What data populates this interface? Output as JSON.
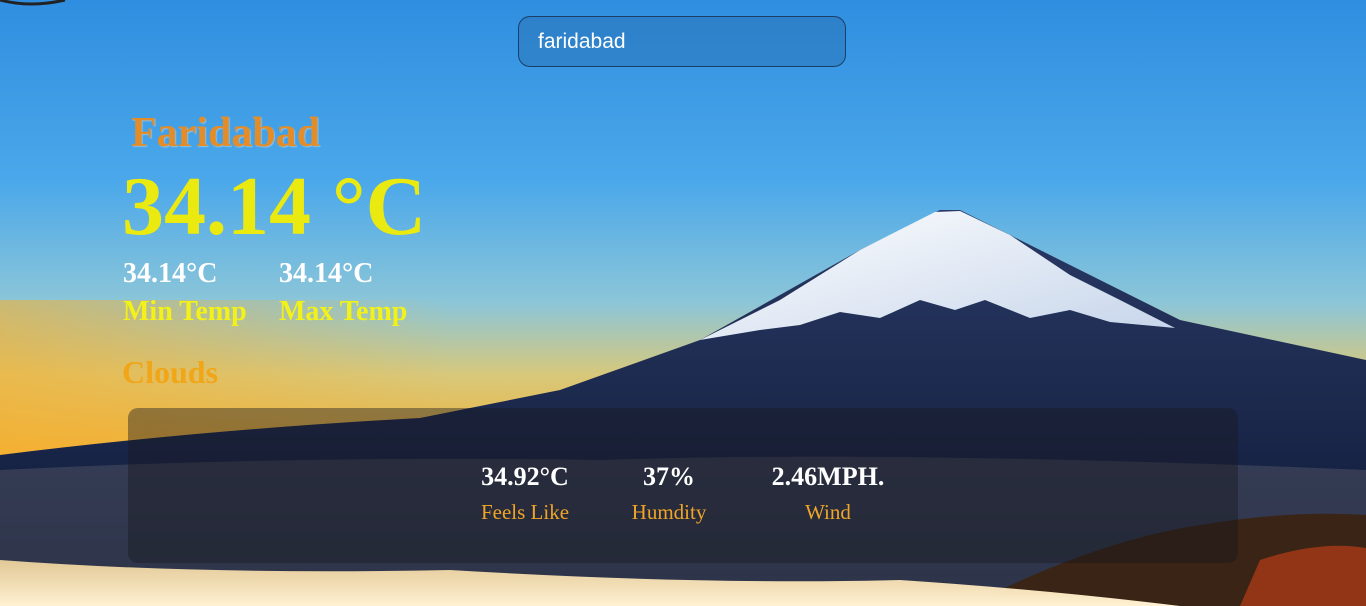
{
  "search": {
    "value": "faridabad"
  },
  "weather": {
    "city": "Faridabad",
    "temperature": "34.14 °C",
    "min_temp": {
      "value": "34.14°C",
      "label": "Min Temp"
    },
    "max_temp": {
      "value": "34.14°C",
      "label": "Max Temp"
    },
    "condition": "Clouds"
  },
  "details": {
    "feels_like": {
      "value": "34.92°C",
      "label": "Feels Like"
    },
    "humidity": {
      "value": "37%",
      "label": "Humdity"
    },
    "wind": {
      "value": "2.46MPH.",
      "label": "Wind"
    }
  },
  "colors": {
    "city": "#e28d2a",
    "temperature": "#eaea10",
    "labels": "#f2f218",
    "condition": "#f0a618",
    "detail_labels": "#f0a428"
  }
}
